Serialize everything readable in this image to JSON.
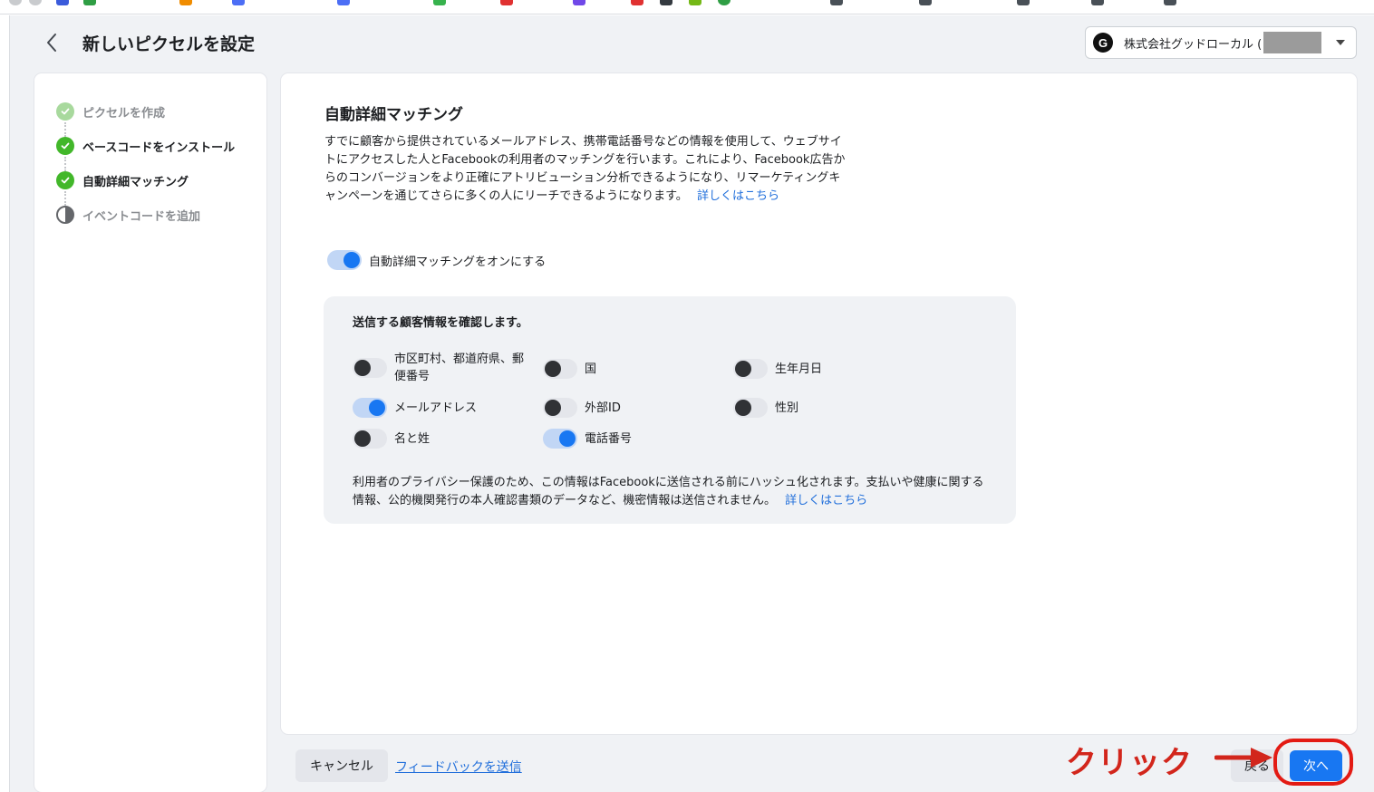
{
  "header": {
    "title": "新しいピクセルを設定",
    "account_name": "株式会社グッドローカル (",
    "account_logo_letter": "G"
  },
  "sidebar": {
    "steps": [
      {
        "label": "ピクセルを作成",
        "state": "done-muted"
      },
      {
        "label": "ベースコードをインストール",
        "state": "done"
      },
      {
        "label": "自動詳細マッチング",
        "state": "done"
      },
      {
        "label": "イベントコードを追加",
        "state": "pending"
      }
    ]
  },
  "main": {
    "section_title": "自動詳細マッチング",
    "description": "すでに顧客から提供されているメールアドレス、携帯電話番号などの情報を使用して、ウェブサイトにアクセスした人とFacebookの利用者のマッチングを行います。これにより、Facebook広告からのコンバージョンをより正確にアトリビューション分析できるようになり、リマーケティングキャンペーンを通じてさらに多くの人にリーチできるようになります。",
    "learn_more": "詳しくはこちら",
    "master_toggle": {
      "label": "自動詳細マッチングをオンにする",
      "on": true
    },
    "panel": {
      "title": "送信する顧客情報を確認します。",
      "fields": [
        {
          "label_line1": "市区町村、都道府県、郵",
          "label_line2": "便番号",
          "on": false
        },
        {
          "label": "国",
          "on": false
        },
        {
          "label": "生年月日",
          "on": false
        },
        {
          "label": "メールアドレス",
          "on": true
        },
        {
          "label": "外部ID",
          "on": false
        },
        {
          "label": "性別",
          "on": false
        },
        {
          "label": "名と姓",
          "on": false
        },
        {
          "label": "電話番号",
          "on": true
        }
      ],
      "privacy_note": "利用者のプライバシー保護のため、この情報はFacebookに送信される前にハッシュ化されます。支払いや健康に関する情報、公的機関発行の本人確認書類のデータなど、機密情報は送信されません。",
      "learn_more": "詳しくはこちら"
    }
  },
  "footer": {
    "cancel_label": "キャンセル",
    "feedback_label": "フィードバックを送信",
    "back_label": "戻る",
    "next_label": "次へ"
  },
  "annotation": {
    "text": "クリック",
    "color": "#d2261c"
  },
  "colors": {
    "accent": "#1877f2",
    "success": "#42b72a",
    "link": "#216fdb",
    "background": "#f0f2f5"
  }
}
